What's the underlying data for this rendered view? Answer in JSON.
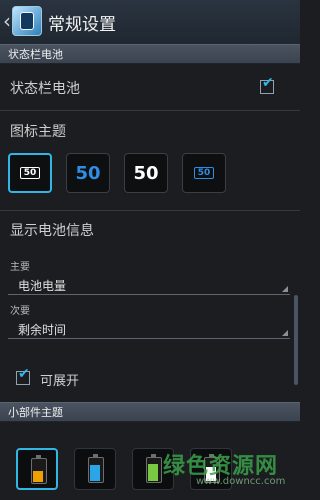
{
  "actionbar": {
    "title": "常规设置"
  },
  "sections": {
    "status_bar_header": "状态栏电池",
    "widget_header": "小部件主题"
  },
  "status_bar": {
    "label": "状态栏电池",
    "checked": true
  },
  "icon_theme": {
    "title": "图标主题",
    "tiles": [
      {
        "text": "50",
        "color": "#ffffff",
        "selected": true
      },
      {
        "text": "50",
        "color": "#2f8de4",
        "selected": false
      },
      {
        "text": "50",
        "color": "#ffffff",
        "selected": false
      },
      {
        "text": "50",
        "color": "#2f8de4",
        "selected": false
      }
    ]
  },
  "battery_info": {
    "title": "显示电池信息",
    "primary_label": "主要",
    "primary_value": "电池电量",
    "secondary_label": "次要",
    "secondary_value": "剩余时间",
    "expandable_label": "可展开",
    "expandable_checked": true
  },
  "widgets": [
    {
      "color": "#f0a000",
      "level": 0.55,
      "selected": true
    },
    {
      "color": "#2aa5e8",
      "level": 0.8,
      "selected": false
    },
    {
      "color": "#7ac943",
      "level": 0.85,
      "selected": false
    },
    {
      "color": "#ffffff",
      "level": 0.7,
      "selected": false
    }
  ],
  "watermark": {
    "text": "绿色资源网",
    "subtext": "www.downcc.com"
  }
}
